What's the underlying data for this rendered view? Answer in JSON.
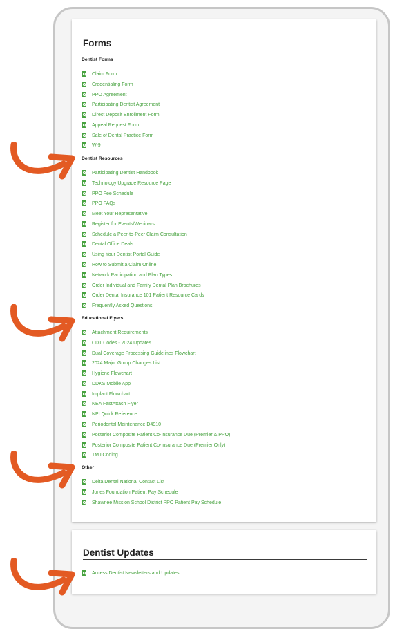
{
  "colors": {
    "link": "#47a23f",
    "icon": "#47a23f",
    "arrow": "#e35a23",
    "frame": "#c6c6c6"
  },
  "forms_card": {
    "title": "Forms",
    "sections": [
      {
        "heading": "Dentist Forms",
        "links": [
          "Claim Form",
          "Credentialing Form",
          "PPO Agreement",
          "Participating Dentist Agreement",
          "Direct Deposit Enrollment Form",
          "Appeal Request Form",
          "Sale of Dental Practice Form",
          "W-9"
        ]
      },
      {
        "heading": "Dentist Resources",
        "links": [
          "Participating Dentist Handbook",
          "Technology Upgrade Resource Page",
          "PPO Fee Schedule",
          "PPO FAQs",
          "Meet Your Representative",
          "Register for Events/Webinars",
          "Schedule a Peer-to-Peer Claim Consultation",
          "Dental Office Deals",
          "Using Your Dentist Portal Guide",
          "How to Submit a Claim Online",
          "Network Participation and Plan Types",
          "Order Individual and Family Dental Plan Brochures",
          "Order Dental Insurance 101 Patient Resource Cards",
          "Frequently Asked Questions"
        ]
      },
      {
        "heading": "Educational Flyers",
        "links": [
          "Attachment Requirements",
          "CDT Codes - 2024 Updates",
          "Dual Coverage Processing Guidelines Flowchart",
          "2024 Major Group Changes List",
          "Hygiene Flowchart",
          "DDKS Mobile App",
          "Implant Flowchart",
          "NEA FastAttach Flyer",
          "NPI Quick Reference",
          "Periodontal Maintenance D4910",
          "Posterior Composite Patient Co-Insurance Due (Premier & PPO)",
          "Posterior Composite Patient Co-Insurance Due (Premier Only)",
          "TMJ Coding"
        ]
      },
      {
        "heading": "Other",
        "links": [
          "Delta Dental National Contact List",
          "Jones Foundation Patient Pay Schedule",
          "Shawnee Mission School District PPO Patient Pay Schedule"
        ]
      }
    ]
  },
  "updates_card": {
    "title": "Dentist Updates",
    "links": [
      "Access Dentist Newsletters and Updates"
    ]
  },
  "icons": {
    "link_icon": "document-search-icon",
    "annotation": "curved-arrow-icon"
  }
}
